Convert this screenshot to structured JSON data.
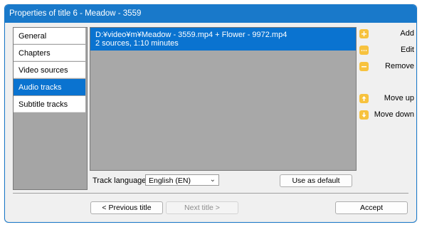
{
  "window": {
    "title": "Properties of title 6 - Meadow - 3559"
  },
  "nav": {
    "items": [
      {
        "label": "General",
        "selected": false
      },
      {
        "label": "Chapters",
        "selected": false
      },
      {
        "label": "Video sources",
        "selected": false
      },
      {
        "label": "Audio tracks",
        "selected": true
      },
      {
        "label": "Subtitle tracks",
        "selected": false
      }
    ]
  },
  "tracks": [
    {
      "line1": "D:¥video¥m¥Meadow - 3559.mp4 + Flower - 9972.mp4",
      "line2": "2 sources, 1:10 minutes",
      "selected": true
    }
  ],
  "language": {
    "label": "Track language",
    "value": "English (EN)"
  },
  "buttons": {
    "use_default": "Use as default",
    "previous": "< Previous title",
    "next": "Next title >",
    "accept": "Accept"
  },
  "actions": {
    "add": "Add",
    "edit": "Edit",
    "remove": "Remove",
    "move_up": "Move up",
    "move_down": "Move down"
  },
  "colors": {
    "accent": "#1979ca",
    "selection": "#0a73d0",
    "action_icon": "#f7c23e"
  }
}
